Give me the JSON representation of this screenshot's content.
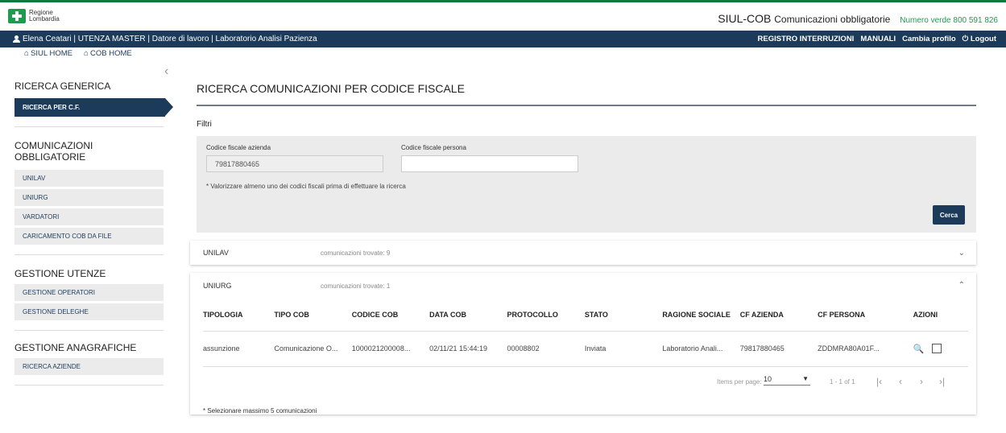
{
  "header": {
    "logo_line1": "Regione",
    "logo_line2": "Lombardia",
    "app_title": "SIUL-COB",
    "app_subtitle": "Comunicazioni obbligatorie",
    "phone": "Numero verde 800 591 826"
  },
  "userbar": {
    "user_info": "Elena Ceatari | UTENZA MASTER | Datore di lavoro | Laboratorio Analisi Pazienza",
    "menu": [
      "REGISTRO INTERRUZIONI",
      "MANUALI",
      "Cambia profilo",
      "Logout"
    ]
  },
  "homelinks": {
    "siul": "SIUL HOME",
    "cob": "COB HOME"
  },
  "sidebar": {
    "ricerca_generica": "RICERCA GENERICA",
    "ricerca_cf": "RICERCA PER C.F.",
    "com_obbligatorie": "COMUNICAZIONI OBBLIGATORIE",
    "com_items": [
      "UNILAV",
      "UNIURG",
      "VARDATORI",
      "CARICAMENTO COB DA FILE"
    ],
    "gestione_utenze": "GESTIONE UTENZE",
    "utenze_items": [
      "GESTIONE OPERATORI",
      "GESTIONE DELEGHE"
    ],
    "gestione_anagrafiche": "GESTIONE ANAGRAFICHE",
    "anagrafiche_items": [
      "RICERCA AZIENDE"
    ]
  },
  "main": {
    "title": "RICERCA COMUNICAZIONI PER CODICE FISCALE",
    "filtri": "Filtri",
    "cf_azienda_label": "Codice fiscale azienda",
    "cf_azienda_value": "79817880465",
    "cf_persona_label": "Codice fiscale persona",
    "cf_persona_value": "",
    "note": "* Valorizzare almeno uno dei codici fiscali prima di effettuare la ricerca",
    "cerca": "Cerca"
  },
  "unilav": {
    "label": "UNILAV",
    "count": "comunicazioni trovate: 9"
  },
  "uniurg": {
    "label": "UNIURG",
    "count": "comunicazioni trovate: 1",
    "columns": [
      "TIPOLOGIA",
      "TIPO COB",
      "CODICE COB",
      "DATA COB",
      "PROTOCOLLO",
      "STATO",
      "RAGIONE SOCIALE",
      "CF AZIENDA",
      "CF PERSONA",
      "AZIONI"
    ],
    "rows": [
      [
        "assunzione",
        "Comunicazione O...",
        "1000021200008...",
        "02/11/21 15:44:19",
        "00008802",
        "Inviata",
        "Laboratorio Anali...",
        "79817880465",
        "ZDDMRA80A01F..."
      ]
    ],
    "items_per_page_label": "Items per page:",
    "items_per_page_value": "10",
    "range": "1 - 1 of 1",
    "select_note": "* Selezionare massimo 5 comunicazioni"
  },
  "icons": [
    "user-icon",
    "home-icon",
    "power-icon",
    "search-icon",
    "chevron-down-icon",
    "chevron-up-icon",
    "chevron-left-icon"
  ]
}
